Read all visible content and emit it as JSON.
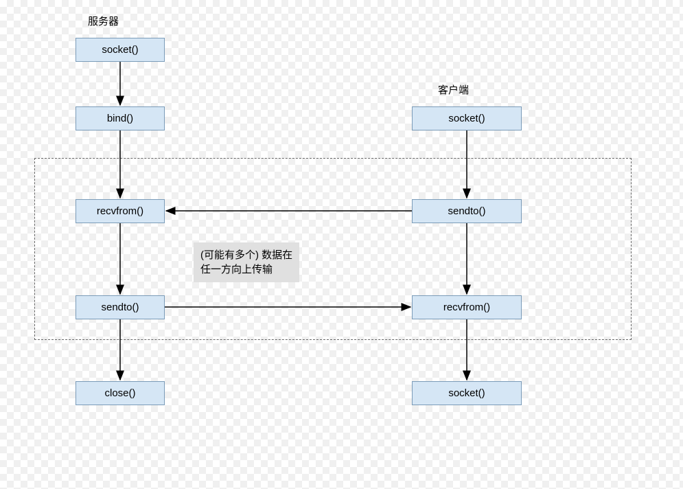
{
  "labels": {
    "server": "服务器",
    "client": "客户端"
  },
  "server_nodes": {
    "socket": "socket()",
    "bind": "bind()",
    "recvfrom": "recvfrom()",
    "sendto": "sendto()",
    "close": "close()"
  },
  "client_nodes": {
    "socket_top": "socket()",
    "sendto": "sendto()",
    "recvfrom": "recvfrom()",
    "socket_bottom": "socket()"
  },
  "note": {
    "line1": "(可能有多个) 数据在",
    "line2": "任一方向上传输"
  }
}
